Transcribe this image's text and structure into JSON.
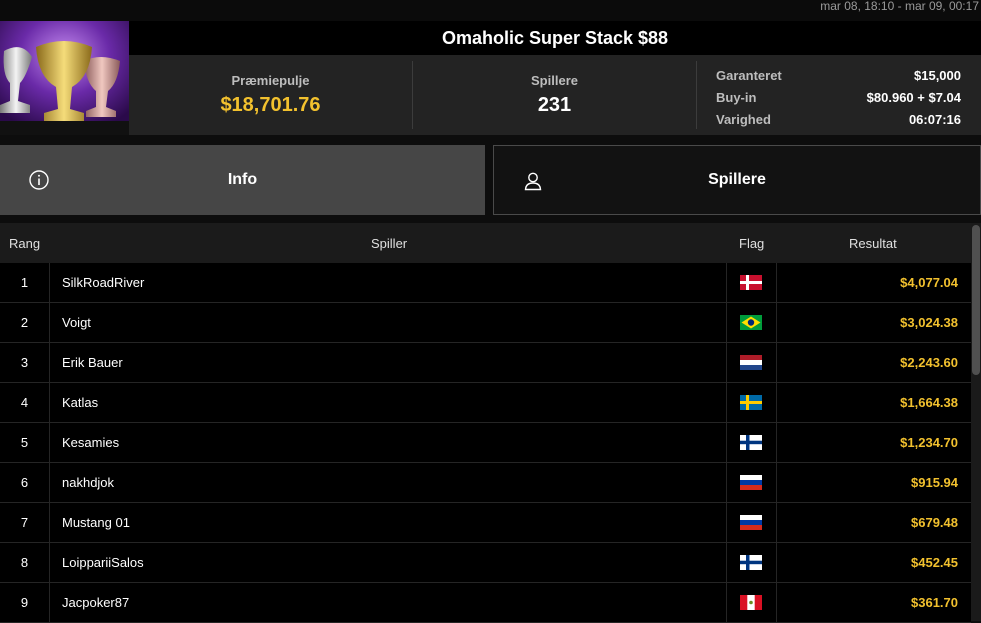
{
  "header": {
    "dates": "mar 08, 18:10 - mar 09, 00:17",
    "title": "Omaholic Super Stack $88"
  },
  "stats": {
    "prize_label": "Præmiepulje",
    "prize_value": "$18,701.76",
    "players_label": "Spillere",
    "players_value": "231",
    "details": [
      {
        "key": "Garanteret",
        "value": "$15,000"
      },
      {
        "key": "Buy-in",
        "value": "$80.960 + $7.04"
      },
      {
        "key": "Varighed",
        "value": "06:07:16"
      }
    ]
  },
  "tabs": {
    "info": "Info",
    "players": "Spillere"
  },
  "table": {
    "headers": {
      "rank": "Rang",
      "player": "Spiller",
      "flag": "Flag",
      "result": "Resultat"
    },
    "rows": [
      {
        "rank": "1",
        "name": "SilkRoadRiver",
        "flag": "denmark-flag-icon",
        "result": "$4,077.04"
      },
      {
        "rank": "2",
        "name": "Voigt",
        "flag": "brazil-flag-icon",
        "result": "$3,024.38"
      },
      {
        "rank": "3",
        "name": "Erik Bauer",
        "flag": "netherlands-flag-icon",
        "result": "$2,243.60"
      },
      {
        "rank": "4",
        "name": "Katlas",
        "flag": "sweden-flag-icon",
        "result": "$1,664.38"
      },
      {
        "rank": "5",
        "name": "Kesamies",
        "flag": "finland-flag-icon",
        "result": "$1,234.70"
      },
      {
        "rank": "6",
        "name": "nakhdjok",
        "flag": "russia-flag-icon",
        "result": "$915.94"
      },
      {
        "rank": "7",
        "name": "Mustang 01",
        "flag": "russia-flag-icon",
        "result": "$679.48"
      },
      {
        "rank": "8",
        "name": "LoippariiSalos",
        "flag": "finland-flag-icon",
        "result": "$452.45"
      },
      {
        "rank": "9",
        "name": "Jacpoker87",
        "flag": "peru-flag-icon",
        "result": "$361.70"
      }
    ]
  },
  "colors": {
    "accent": "#f2c12e",
    "active_tab": "#464646"
  }
}
